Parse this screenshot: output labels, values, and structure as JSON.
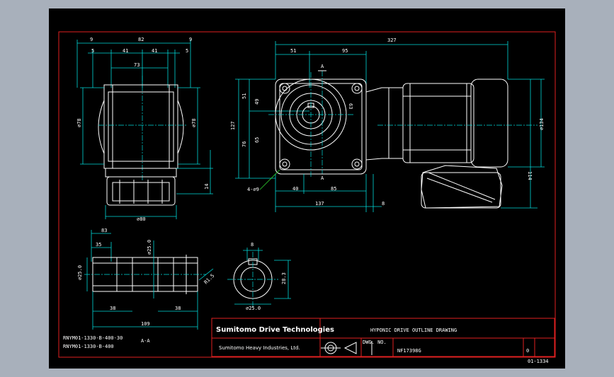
{
  "title_block": {
    "title": "HYPONIC DRIVE OUTLINE DRAWING",
    "brand": "Sumitomo Drive Technologies",
    "maker": "Sumitomo Heavy Industries, Ltd.",
    "drawing_number": "NF17398G",
    "revision": "0",
    "dwg_no_label": "DWG. NO.",
    "sheet_code": "01-1334"
  },
  "models": [
    "RNYM01-1330-B-400-30",
    "RNYM01-1330-B-400"
  ],
  "section_label": "A-A",
  "section_marker": "A",
  "dimensions": {
    "front": [
      "9",
      "82",
      "9",
      "5",
      "41",
      "41",
      "5",
      "73",
      "⌀78",
      "⌀78",
      "14",
      "⌀80"
    ],
    "main": [
      "327",
      "51",
      "95",
      "A",
      "51",
      "49",
      "65",
      "76",
      "127",
      "63",
      "4-⌀9",
      "40",
      "85",
      "137",
      "8",
      "⌀134",
      "114",
      "A"
    ],
    "shaft": [
      "83",
      "35",
      "⌀25.0",
      "⌀25.0",
      "R1.5",
      "38",
      "38",
      "109"
    ],
    "key": [
      "8",
      "28.3",
      "⌀25.0"
    ]
  }
}
